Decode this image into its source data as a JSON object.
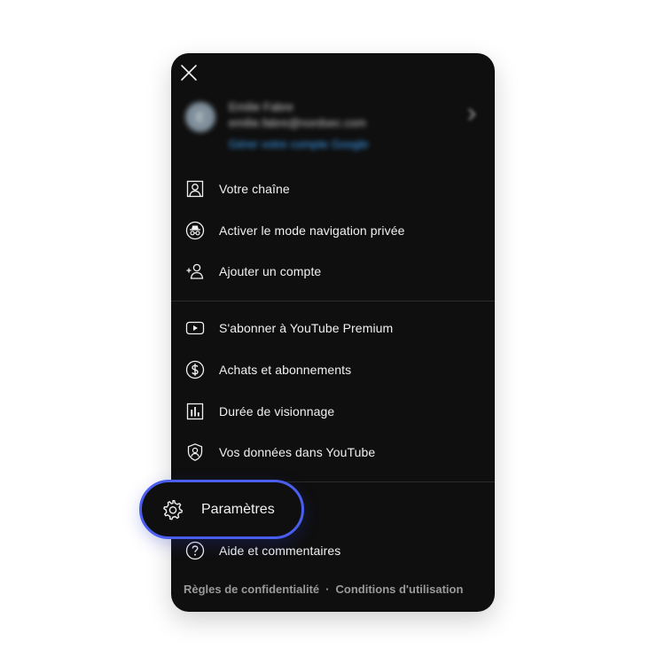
{
  "account": {
    "initial": "E",
    "name": "Emilie Fabre",
    "email": "emilie.fabre@nordsec.com",
    "manage_label": "Gérer votre compte Google"
  },
  "icons": {
    "close": "close-icon",
    "chevron": "chevron-right-icon"
  },
  "menu_group_1": [
    {
      "label": "Votre chaîne",
      "icon": "channel-icon"
    },
    {
      "label": "Activer le mode navigation privée",
      "icon": "incognito-icon"
    },
    {
      "label": "Ajouter un compte",
      "icon": "add-account-icon"
    }
  ],
  "menu_group_2": [
    {
      "label": "S'abonner à YouTube Premium",
      "icon": "youtube-icon"
    },
    {
      "label": "Achats et abonnements",
      "icon": "dollar-icon"
    },
    {
      "label": "Durée de visionnage",
      "icon": "bar-chart-icon"
    },
    {
      "label": "Vos données dans YouTube",
      "icon": "shield-user-icon"
    }
  ],
  "menu_group_3": [
    {
      "label": "Paramètres",
      "icon": "gear-icon",
      "highlighted": true
    },
    {
      "label": "Aide et commentaires",
      "icon": "help-icon"
    }
  ],
  "footer": {
    "privacy": "Règles de confidentialité",
    "separator": "·",
    "terms": "Conditions d'utilisation"
  },
  "colors": {
    "panel_bg": "#0f0f0f",
    "text": "#f1f1f1",
    "link_blue": "#3ea6ff",
    "highlight_border": "#4a5ff0",
    "footer_text": "#9a9a9a"
  }
}
